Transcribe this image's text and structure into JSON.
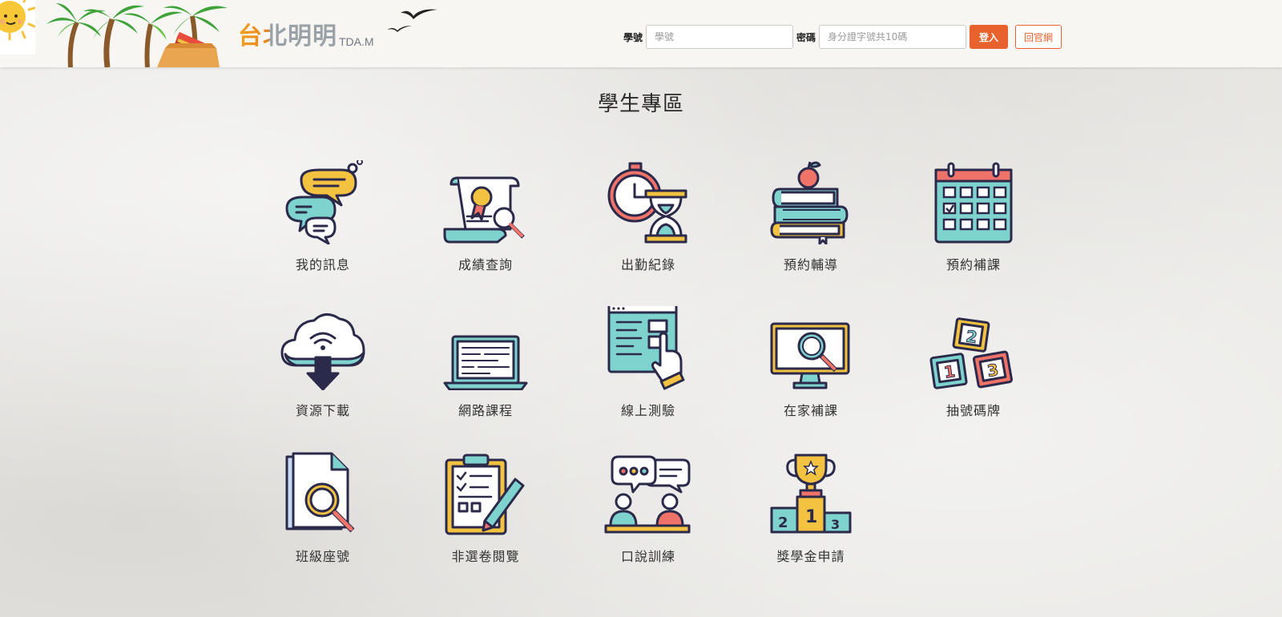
{
  "header": {
    "brand_cn": "台北明明",
    "brand_en": "TDA.M",
    "student_id_label": "學號",
    "student_id_placeholder": "學號",
    "password_label": "密碼",
    "password_placeholder": "身分證字號共10碼",
    "login_button": "登入",
    "home_button": "回官網"
  },
  "page_title": "學生專區",
  "tiles": [
    {
      "label": "我的訊息",
      "icon": "chat-bubbles-icon"
    },
    {
      "label": "成績查詢",
      "icon": "certificate-search-icon"
    },
    {
      "label": "出勤紀錄",
      "icon": "clock-hourglass-icon"
    },
    {
      "label": "預約輔導",
      "icon": "books-apple-icon"
    },
    {
      "label": "預約補課",
      "icon": "calendar-icon"
    },
    {
      "label": "資源下載",
      "icon": "cloud-download-icon"
    },
    {
      "label": "網路課程",
      "icon": "laptop-icon"
    },
    {
      "label": "線上測驗",
      "icon": "web-click-icon"
    },
    {
      "label": "在家補課",
      "icon": "monitor-search-icon"
    },
    {
      "label": "抽號碼牌",
      "icon": "number-blocks-icon"
    },
    {
      "label": "班級座號",
      "icon": "document-search-icon"
    },
    {
      "label": "非選卷閱覽",
      "icon": "checklist-pencil-icon"
    },
    {
      "label": "口說訓練",
      "icon": "conversation-icon"
    },
    {
      "label": "獎學金申請",
      "icon": "trophy-podium-icon"
    }
  ],
  "colors": {
    "accent": "#e8622d",
    "teal": "#7fd3cf",
    "yellow": "#f4c241",
    "red": "#f0736a",
    "outline": "#2c2a4a"
  }
}
